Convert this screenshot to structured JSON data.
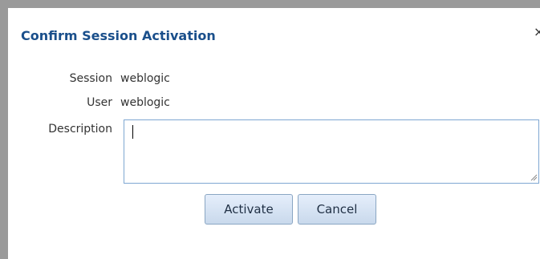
{
  "dialog": {
    "title": "Confirm Session Activation",
    "close_glyph": "×"
  },
  "fields": {
    "session_label": "Session",
    "session_value": "weblogic",
    "user_label": "User",
    "user_value": "weblogic",
    "description_label": "Description",
    "description_value": ""
  },
  "buttons": {
    "activate": "Activate",
    "cancel": "Cancel"
  },
  "colors": {
    "title": "#1a4f8b",
    "input_border": "#7fa7d2",
    "button_gradient_top": "#e5eefb",
    "button_gradient_bottom": "#c9d9ec"
  }
}
